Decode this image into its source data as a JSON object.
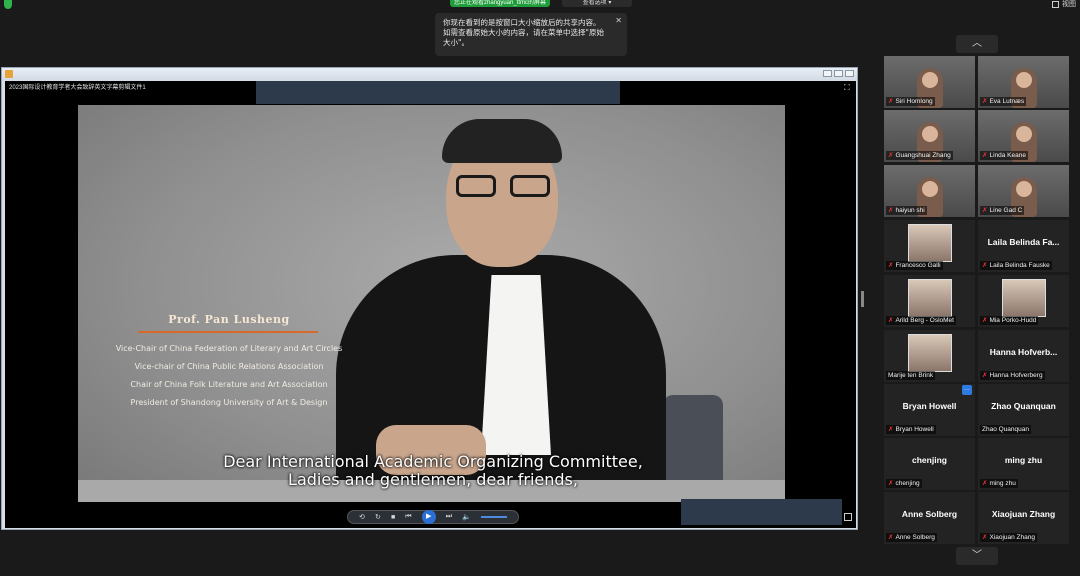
{
  "top_bar": {
    "share_status": "您正在观看zhangyuan_ttmc的屏幕",
    "view_options": "查看选项 ▾",
    "view_label": "视图"
  },
  "tooltip": {
    "lines": [
      "你现在看到的是按窗口大小缩放后的共享内容。",
      "如需查看原始大小的内容，请在菜单中选择\"原始",
      "大小\"。"
    ]
  },
  "shared_window": {
    "player_title": "2023国际设计教育学者大会致辞英文字幕剪辑文件1",
    "video": {
      "speaker_name": "Prof. Pan Lusheng",
      "titles": [
        "Vice-Chair of China Federation of Literary and Art Circles",
        "Vice-chair of China Public Relations Association",
        "Chair of China Folk Literature and Art Association",
        "President of Shandong University of Art & Design"
      ],
      "subtitle_lines": [
        "Dear International Academic Organizing Committee,",
        "Ladies and gentlemen, dear friends,"
      ]
    }
  },
  "participants": [
    {
      "name": "Siri Homlong",
      "big": "",
      "type": "photo",
      "muted": true
    },
    {
      "name": "Eva Lutnæs",
      "big": "",
      "type": "photo",
      "muted": true
    },
    {
      "name": "Guangshuai Zhang",
      "big": "",
      "type": "photo",
      "muted": true
    },
    {
      "name": "Linda Keane",
      "big": "",
      "type": "photo",
      "muted": true
    },
    {
      "name": "haiyun shi",
      "big": "",
      "type": "photo",
      "muted": true
    },
    {
      "name": "Line Gad C",
      "big": "",
      "type": "photo",
      "muted": true
    },
    {
      "name": "Francesco Galli",
      "big": "",
      "type": "avatar",
      "muted": true
    },
    {
      "name": "Laila Belinda Fauske",
      "big": "Laila Belinda Fa...",
      "type": "text",
      "muted": true
    },
    {
      "name": "Arild Berg - OsloMet",
      "big": "",
      "type": "avatar",
      "muted": true
    },
    {
      "name": "Mia Porko-Hudd",
      "big": "",
      "type": "avatar",
      "muted": true
    },
    {
      "name": "Marije ten Brink",
      "big": "",
      "type": "avatar",
      "muted": false
    },
    {
      "name": "Hanna Hofverberg",
      "big": "Hanna Hofverb...",
      "type": "text",
      "muted": true
    },
    {
      "name": "Bryan Howell",
      "big": "Bryan Howell",
      "type": "text",
      "muted": true
    },
    {
      "name": "Zhao Quanquan",
      "big": "Zhao Quanquan",
      "type": "text",
      "muted": false
    },
    {
      "name": "chenjing",
      "big": "chenjing",
      "type": "text",
      "muted": true
    },
    {
      "name": "ming zhu",
      "big": "ming zhu",
      "type": "text",
      "muted": true
    },
    {
      "name": "Anne Solberg",
      "big": "Anne Solberg",
      "type": "text",
      "muted": true
    },
    {
      "name": "Xiaojuan Zhang",
      "big": "Xiaojuan Zhang",
      "type": "text",
      "muted": true
    }
  ],
  "colors": {
    "background": "#1a1a1a",
    "accent": "#d66a2a",
    "share_green": "#1f9d3a"
  }
}
